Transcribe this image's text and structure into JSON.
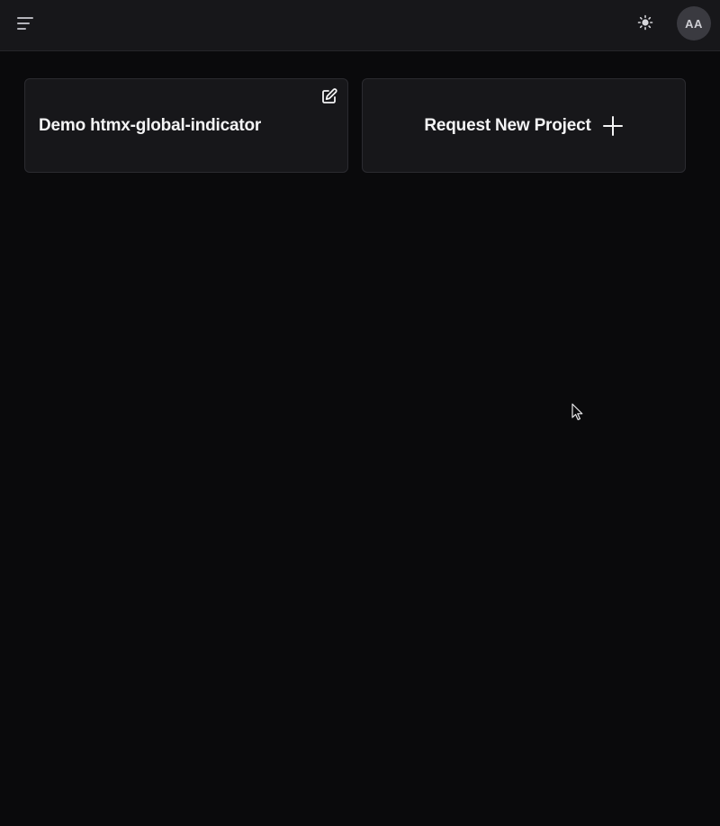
{
  "header": {
    "menu_icon": "menu-icon",
    "theme_icon": "sun-icon",
    "avatar_initials": "AA"
  },
  "projects": [
    {
      "title": "Demo htmx-global-indicator",
      "action_icon": "edit-icon"
    }
  ],
  "request_card": {
    "label": "Request New Project",
    "icon": "plus-icon"
  },
  "colors": {
    "background": "#0a0a0c",
    "surface": "#17171a",
    "border": "#2b2b30",
    "text": "#f4f4f5",
    "avatar_bg": "#3a3a40"
  }
}
